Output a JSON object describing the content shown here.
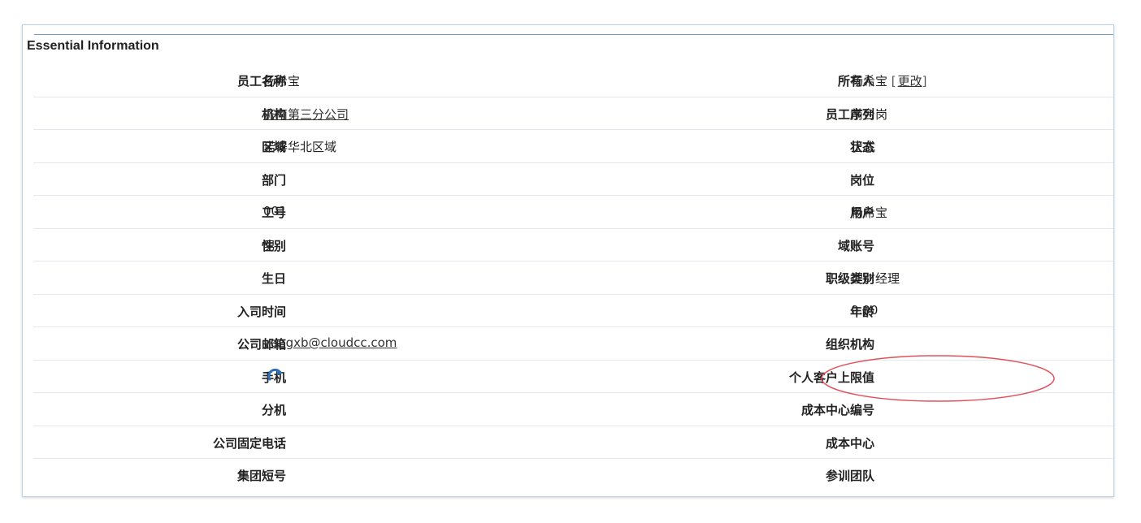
{
  "section": {
    "title": "Essential Information"
  },
  "colors": {
    "border": "#bcd4e6",
    "topline": "#6f9fc5",
    "row_divider": "#e3e9ee",
    "annotation": "#e0505a",
    "icon": "#2a6fb8"
  },
  "rows": [
    {
      "left": {
        "label": "员工名称",
        "value": "杨希宝"
      },
      "right": {
        "label": "所有人",
        "value": "杨希宝",
        "action": "更改"
      }
    },
    {
      "left": {
        "label": "机构",
        "value": "济南第三分公司"
      },
      "right": {
        "label": "员工序列",
        "value": "前台岗"
      }
    },
    {
      "left": {
        "label": "区域",
        "value": "诺得华北区域"
      },
      "right": {
        "label": "状态",
        "value": "正式"
      }
    },
    {
      "left": {
        "label": "部门",
        "value": ""
      },
      "right": {
        "label": "岗位",
        "value": ""
      }
    },
    {
      "left": {
        "label": "工号",
        "value": "001"
      },
      "right": {
        "label": "用户",
        "value": "杨希宝"
      }
    },
    {
      "left": {
        "label": "性别",
        "value": "男"
      },
      "right": {
        "label": "域账号",
        "value": ""
      }
    },
    {
      "left": {
        "label": "生日",
        "value": ""
      },
      "right": {
        "label": "职级类别",
        "value": "理财经理"
      }
    },
    {
      "left": {
        "label": "入司时间",
        "value": ""
      },
      "right": {
        "label": "年龄",
        "value": "0.00"
      }
    },
    {
      "left": {
        "label": "公司邮箱",
        "value": "yangxb@cloudcc.com"
      },
      "right": {
        "label": "组织机构",
        "value": ""
      }
    },
    {
      "left": {
        "label": "手机",
        "value": "",
        "icon": "refresh-icon"
      },
      "right": {
        "label": "个人客户上限值",
        "value": ""
      }
    },
    {
      "left": {
        "label": "分机",
        "value": ""
      },
      "right": {
        "label": "成本中心编号",
        "value": ""
      }
    },
    {
      "left": {
        "label": "公司固定电话",
        "value": ""
      },
      "right": {
        "label": "成本中心",
        "value": ""
      }
    },
    {
      "left": {
        "label": "集团短号",
        "value": ""
      },
      "right": {
        "label": "参训团队",
        "value": ""
      }
    }
  ]
}
